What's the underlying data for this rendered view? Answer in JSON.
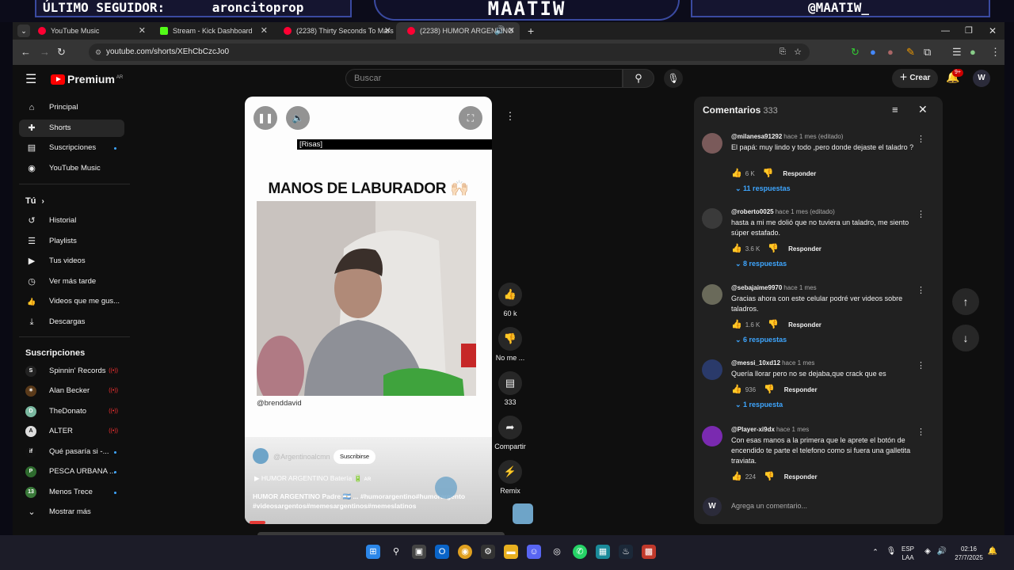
{
  "overlay": {
    "left_label": "ÚLTIMO SEGUIDOR:",
    "left_value": "aroncitoprop",
    "center": "MAATIW",
    "right": "@MAATIW_"
  },
  "browser": {
    "tabs": [
      {
        "title": "YouTube Music",
        "color": "#ff0033"
      },
      {
        "title": "Stream - Kick Dashboard",
        "color": "#53fc18"
      },
      {
        "title": "(2238) Thirty Seconds To Mars",
        "color": "#ff0033"
      },
      {
        "title": "(2238) HUMOR ARGENTINO",
        "color": "#ff0033"
      }
    ],
    "url": "youtube.com/shorts/XEhCbCzcJo0"
  },
  "masthead": {
    "logo": "Premium",
    "region": "AR",
    "search_placeholder": "Buscar",
    "create_label": "Crear",
    "notif_badge": "9+"
  },
  "sidebar": {
    "main": [
      {
        "label": "Principal",
        "icon": "home-icon",
        "glyph": "⌂"
      },
      {
        "label": "Shorts",
        "icon": "shorts-icon",
        "glyph": "✚"
      },
      {
        "label": "Suscripciones",
        "icon": "subscriptions-icon",
        "glyph": "▤"
      },
      {
        "label": "YouTube Music",
        "icon": "music-icon",
        "glyph": "◉"
      }
    ],
    "you_heading": "Tú",
    "you": [
      {
        "label": "Historial",
        "icon": "history-icon",
        "glyph": "↺"
      },
      {
        "label": "Playlists",
        "icon": "playlists-icon",
        "glyph": "☰"
      },
      {
        "label": "Tus videos",
        "icon": "your-videos-icon",
        "glyph": "▶"
      },
      {
        "label": "Ver más tarde",
        "icon": "watch-later-icon",
        "glyph": "◷"
      },
      {
        "label": "Videos que me gus...",
        "icon": "liked-icon",
        "glyph": "👍"
      },
      {
        "label": "Descargas",
        "icon": "downloads-icon",
        "glyph": "⤓"
      }
    ],
    "subs_heading": "Suscripciones",
    "subs": [
      {
        "label": "Spinnin' Records",
        "color": "#222222",
        "mark": "S",
        "live": true
      },
      {
        "label": "Alan Becker",
        "color": "#5a3a1a",
        "mark": "✶",
        "live": true
      },
      {
        "label": "TheDonato",
        "color": "#7ab8a0",
        "mark": "D",
        "live": true
      },
      {
        "label": "ALTER",
        "color": "#dddddd",
        "mark": "A",
        "live": true
      },
      {
        "label": "Qué pasaría si -...",
        "color": "#111111",
        "mark": "if",
        "live": false
      },
      {
        "label": "PESCA URBANA ...",
        "color": "#2e6b2e",
        "mark": "P",
        "live": false
      },
      {
        "label": "Menos Trece",
        "color": "#3a7a3a",
        "mark": "13",
        "live": false
      }
    ],
    "more_label": "Mostrar más"
  },
  "short": {
    "caption": "[Risas]",
    "title": "MANOS DE LABURADOR 🙌🏻",
    "handle": "@brenddavid",
    "channel": "@Argentinoalcmn",
    "subscribe_label": "Suscribirse",
    "music": "HUMOR ARGENTINO Batería 🔋 ᴀʀ",
    "description_1": "HUMOR ARGENTINO Padre 🇦🇷 ... #humorargentino#humorargento",
    "description_2": "#videosargentos#memesargentinos#memeslatinos"
  },
  "actions": {
    "likes": "60 k",
    "dislike_label": "No me ...",
    "comments": "333",
    "share_label": "Compartir",
    "remix_label": "Remix"
  },
  "comments": {
    "title": "Comentarios",
    "count": "333",
    "items": [
      {
        "user": "@milanesa91292",
        "time": "hace 1 mes (editado)",
        "text": "El papá: muy lindo y todo ,pero donde dejaste el taladro ?",
        "likes": "6 K",
        "reply": "Responder",
        "replies": "11 respuestas",
        "color": "#7a5a5a"
      },
      {
        "user": "@roberto0025",
        "time": "hace 1 mes (editado)",
        "text": "hasta a mi me dolió que no tuviera un taladro, me siento súper estafado.",
        "likes": "3.6 K",
        "reply": "Responder",
        "replies": "8 respuestas",
        "color": "#3a3a3a"
      },
      {
        "user": "@sebajaime9970",
        "time": "hace 1 mes",
        "text": "Gracias ahora con este celular podré ver videos sobre taladros.",
        "likes": "1.6 K",
        "reply": "Responder",
        "replies": "6 respuestas",
        "color": "#6a6a5a"
      },
      {
        "user": "@messi_10xd12",
        "time": "hace 1 mes",
        "text": "Quería llorar pero no se dejaba,que crack que es",
        "likes": "936",
        "reply": "Responder",
        "replies": "1 respuesta",
        "color": "#2a3a6a"
      },
      {
        "user": "@Player-xi9dx",
        "time": "hace 1 mes",
        "text": "Con esas manos a la primera que le aprete el botón de encendido te parte el telefono como si fuera una galletita traviata.",
        "likes": "224",
        "reply": "Responder",
        "replies": "",
        "color": "#7a2ab0"
      }
    ],
    "add_placeholder": "Agrega un comentario..."
  },
  "taskbar": {
    "lang_1": "ESP",
    "lang_2": "LAA",
    "time": "02:16",
    "date": "27/7/2025"
  }
}
